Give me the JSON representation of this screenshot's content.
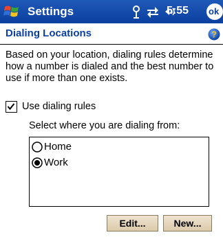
{
  "titlebar": {
    "app_title": "Settings",
    "time": "5:55",
    "ok_label": "ok",
    "icons": [
      "start-logo",
      "connectivity-icon",
      "network-sync-icon",
      "volume-icon"
    ],
    "background": "#0b3fa0"
  },
  "header": {
    "title": "Dialing Locations",
    "help_icon": "help-icon",
    "title_color": "#0b3fa0"
  },
  "content": {
    "description": "Based on your location, dialing rules determine how a number is dialed and the best number to use if more than one exists.",
    "use_rules": {
      "label": "Use dialing rules",
      "checked": true
    },
    "select_label": "Select where you are dialing from:",
    "locations": [
      {
        "label": "Home",
        "selected": false
      },
      {
        "label": "Work",
        "selected": true
      }
    ]
  },
  "buttons": {
    "edit": "Edit...",
    "new": "New..."
  }
}
